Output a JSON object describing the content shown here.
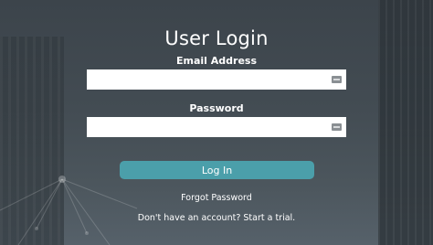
{
  "page": {
    "title": "User Login"
  },
  "form": {
    "email_label": "Email Address",
    "email_value": "",
    "email_placeholder": "",
    "password_label": "Password",
    "password_value": "",
    "password_placeholder": "",
    "submit_label": "Log In"
  },
  "links": {
    "forgot_password": "Forgot Password",
    "signup_prompt": "Don't have an account? Start a trial."
  },
  "icons": {
    "email_field_icon": "keyboard-icon",
    "password_field_icon": "keyboard-icon"
  },
  "colors": {
    "background": "#3f474d",
    "button": "#4b9faa",
    "text": "#ffffff"
  }
}
